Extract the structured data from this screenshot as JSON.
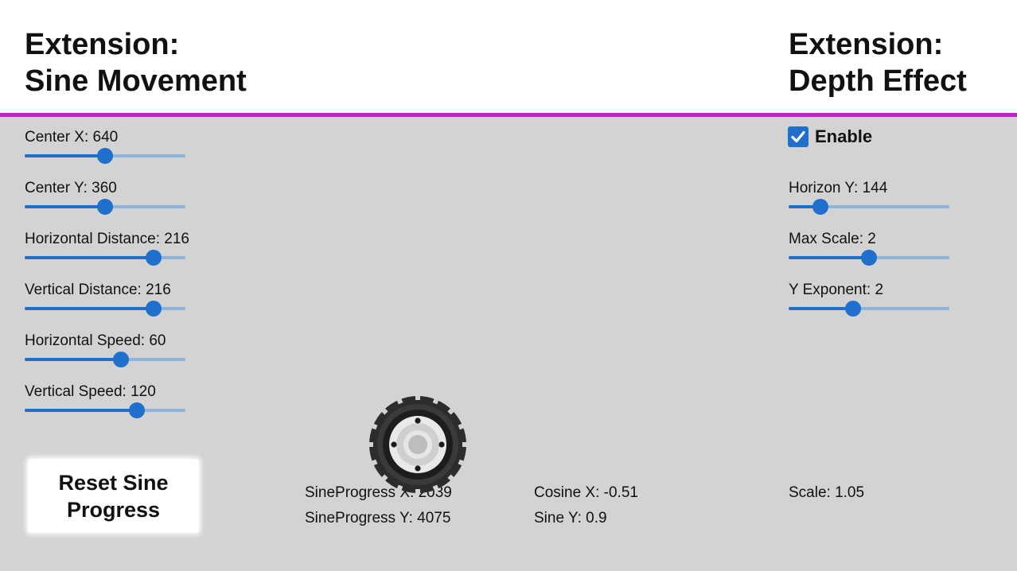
{
  "header": {
    "left_title_line1": "Extension:",
    "left_title_line2": "Sine Movement",
    "right_title_line1": "Extension:",
    "right_title_line2": "Depth Effect",
    "rule_color": "#c31fd6"
  },
  "sine_controls": [
    {
      "label": "Center X: 640",
      "value": 640,
      "fraction": 0.5
    },
    {
      "label": "Center Y: 360",
      "value": 360,
      "fraction": 0.5
    },
    {
      "label": "Horizontal Distance: 216",
      "value": 216,
      "fraction": 0.8
    },
    {
      "label": "Vertical Distance: 216",
      "value": 216,
      "fraction": 0.8
    },
    {
      "label": "Horizontal Speed: 60",
      "value": 60,
      "fraction": 0.6
    },
    {
      "label": "Vertical Speed: 120",
      "value": 120,
      "fraction": 0.7
    }
  ],
  "depth_controls": {
    "enable_label": "Enable",
    "enabled": true,
    "sliders": [
      {
        "label": "Horizon Y: 144",
        "value": 144,
        "fraction": 0.2
      },
      {
        "label": "Max Scale: 2",
        "value": 2,
        "fraction": 0.5
      },
      {
        "label": "Y Exponent: 2",
        "value": 2,
        "fraction": 0.4
      }
    ]
  },
  "reset_button": {
    "line1": "Reset Sine",
    "line2": "Progress"
  },
  "readouts": {
    "sine_progress_x": "SineProgress X: 2039",
    "sine_progress_y": "SineProgress Y: 4075",
    "cosine_x": "Cosine X: -0.51",
    "sine_y": "Sine Y: 0.9",
    "scale": "Scale: 1.05"
  },
  "colors": {
    "accent": "#1f6fcd",
    "track": "#8fb3dc",
    "background": "#d3d3d3"
  },
  "sprite": "wheel-icon"
}
